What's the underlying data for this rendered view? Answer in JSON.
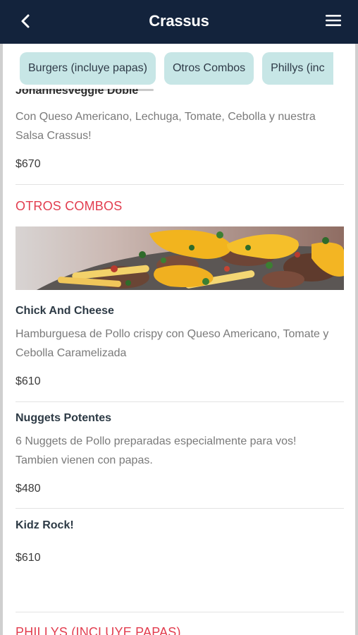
{
  "header": {
    "title": "Crassus",
    "back_icon": "chevron-left-icon",
    "menu_icon": "hamburger-menu-icon"
  },
  "categories": [
    "Burgers (incluye papas)",
    "Otros Combos",
    "Phillys (inc"
  ],
  "items_top": {
    "partial_name": "Johannesveggie Doble",
    "description": "Con Queso Americano, Lechuga, Tomate, Cebolla y nuestra Salsa Crassus!",
    "price": "$670"
  },
  "section": {
    "title": "OTROS COMBOS",
    "image_alt": "Papas fritas con cheddar y carne"
  },
  "items": [
    {
      "name": "Chick And Cheese",
      "description": "Hamburguesa de Pollo crispy con Queso Americano, Tomate y Cebolla Caramelizada",
      "price": "$610"
    },
    {
      "name": "Nuggets Potentes",
      "description": "6 Nuggets de Pollo preparadas especialmente para vos! Tambien vienen con papas.",
      "price": "$480"
    },
    {
      "name": "Kidz Rock!",
      "description": "",
      "price": "$610"
    }
  ],
  "next_section": {
    "title": "PHILLYS (INCLUYE PAPAS)"
  },
  "colors": {
    "appbar": "#13233c",
    "chip": "#c7e6e6",
    "section_title": "#e23d4f"
  }
}
